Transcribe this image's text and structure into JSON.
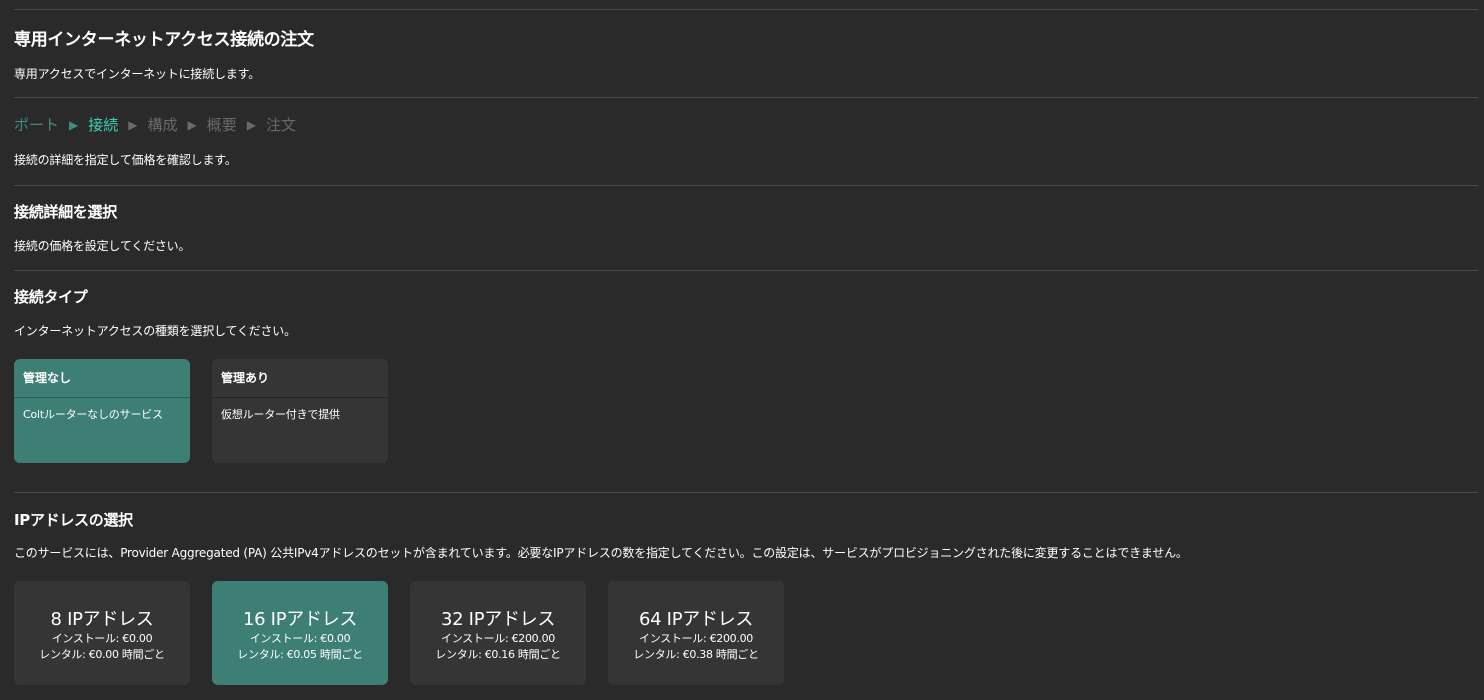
{
  "header": {
    "title": "専用インターネットアクセス接続の注文",
    "subtitle": "専用アクセスでインターネットに接続します。"
  },
  "stepper": {
    "steps": [
      {
        "label": "ポート",
        "state": "done"
      },
      {
        "label": "接続",
        "state": "active"
      },
      {
        "label": "構成",
        "state": "pending"
      },
      {
        "label": "概要",
        "state": "pending"
      },
      {
        "label": "注文",
        "state": "pending"
      }
    ],
    "arrow": "▶",
    "description": "接続の詳細を指定して価格を確認します。"
  },
  "details": {
    "title": "接続詳細を選択",
    "description": "接続の価格を設定してください。"
  },
  "connection_type": {
    "title": "接続タイプ",
    "description": "インターネットアクセスの種類を選択してください。",
    "options": [
      {
        "title": "管理なし",
        "body": "Coltルーターなしのサービス",
        "selected": true
      },
      {
        "title": "管理あり",
        "body": "仮想ルーター付きで提供",
        "selected": false
      }
    ]
  },
  "ip_selection": {
    "title": "IPアドレスの選択",
    "description": "このサービスには、Provider Aggregated (PA) 公共IPv4アドレスのセットが含まれています。必要なIPアドレスの数を指定してください。この設定は、サービスがプロビジョニングされた後に変更することはできません。",
    "options": [
      {
        "title": "8 IPアドレス",
        "install": "インストール: €0.00",
        "rental": "レンタル: €0.00 時間ごと",
        "selected": false
      },
      {
        "title": "16 IPアドレス",
        "install": "インストール: €0.00",
        "rental": "レンタル: €0.05 時間ごと",
        "selected": true
      },
      {
        "title": "32 IPアドレス",
        "install": "インストール: €200.00",
        "rental": "レンタル: €0.16 時間ごと",
        "selected": false
      },
      {
        "title": "64 IPアドレス",
        "install": "インストール: €200.00",
        "rental": "レンタル: €0.38 時間ごと",
        "selected": false
      }
    ]
  },
  "colors": {
    "background": "#2a2a2a",
    "card": "#353535",
    "selected": "#3d7f75",
    "step_active": "#3fd1b5",
    "step_done": "#3d8c80"
  }
}
